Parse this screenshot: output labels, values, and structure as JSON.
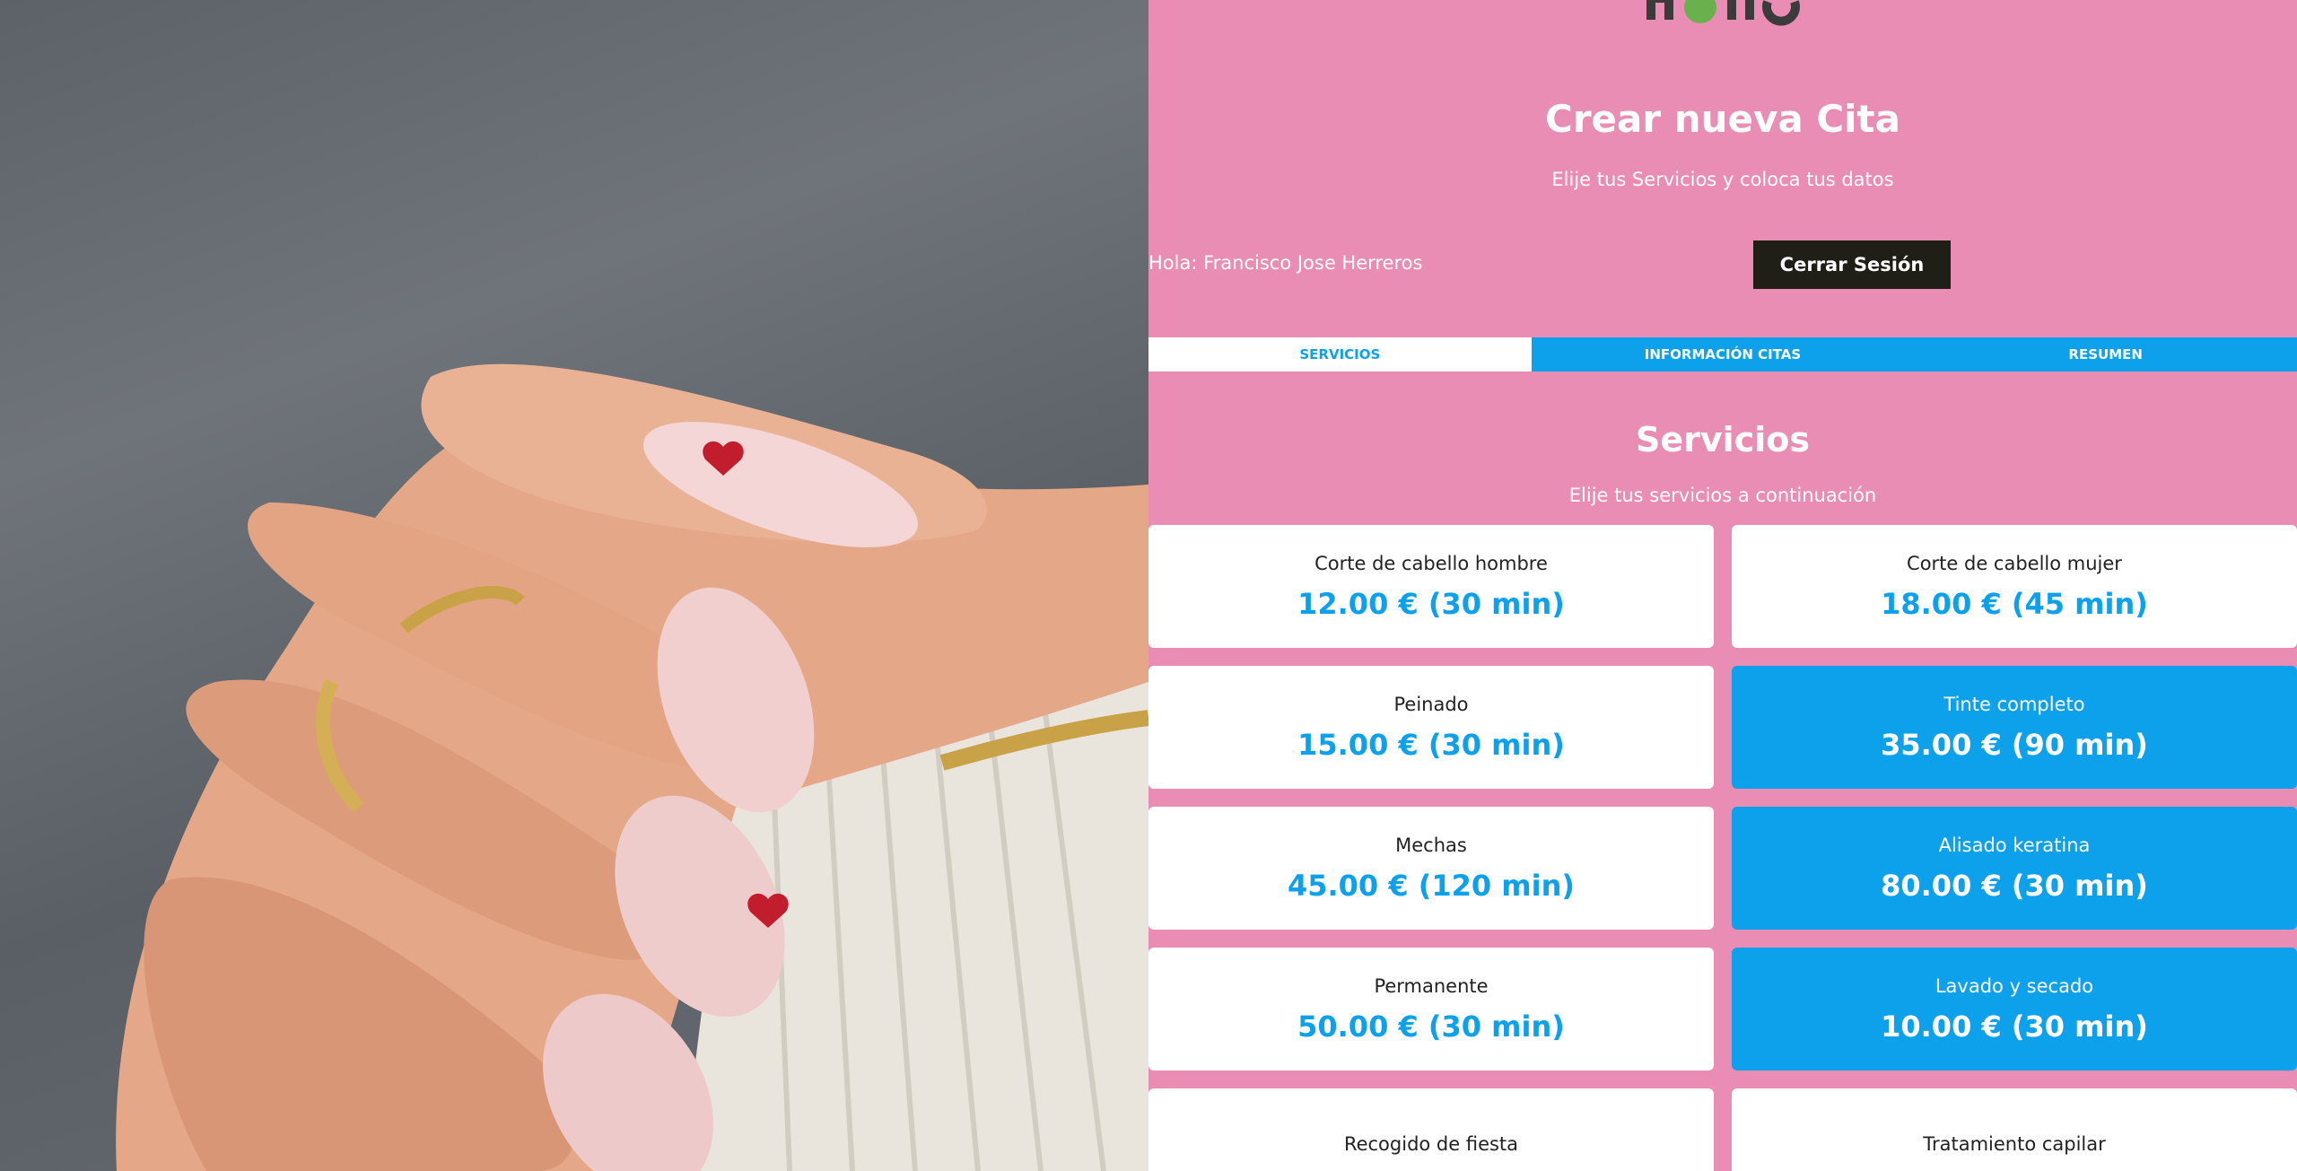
{
  "header": {
    "title": "Crear nueva Cita",
    "subtitle": "Elije tus Servicios y coloca tus datos"
  },
  "user": {
    "greeting": "Hola: Francisco Jose Herreros",
    "logout_label": "Cerrar Sesión"
  },
  "tabs": [
    {
      "label": "Servicios",
      "active": true
    },
    {
      "label": "Información Citas",
      "active": false
    },
    {
      "label": "Resumen",
      "active": false
    }
  ],
  "services_section": {
    "title": "Servicios",
    "subtitle": "Elije tus servicios a continuación"
  },
  "services": [
    {
      "name": "Corte de cabello hombre",
      "price": "12.00 € (30 min)",
      "selected": false
    },
    {
      "name": "Corte de cabello mujer",
      "price": "18.00 € (45 min)",
      "selected": false
    },
    {
      "name": "Peinado",
      "price": "15.00 € (30 min)",
      "selected": false
    },
    {
      "name": "Tinte completo",
      "price": "35.00 € (90 min)",
      "selected": true
    },
    {
      "name": "Mechas",
      "price": "45.00 € (120 min)",
      "selected": false
    },
    {
      "name": "Alisado keratina",
      "price": "80.00 € (30 min)",
      "selected": true
    },
    {
      "name": "Permanente",
      "price": "50.00 € (30 min)",
      "selected": false
    },
    {
      "name": "Lavado y secado",
      "price": "10.00 € (30 min)",
      "selected": true
    },
    {
      "name": "Recogido de fiesta",
      "price": "",
      "selected": false
    },
    {
      "name": "Tratamiento capilar",
      "price": "",
      "selected": false
    }
  ],
  "colors": {
    "background": "#e98db5",
    "accent": "#0da1ec",
    "button_dark": "#1f1f17"
  }
}
